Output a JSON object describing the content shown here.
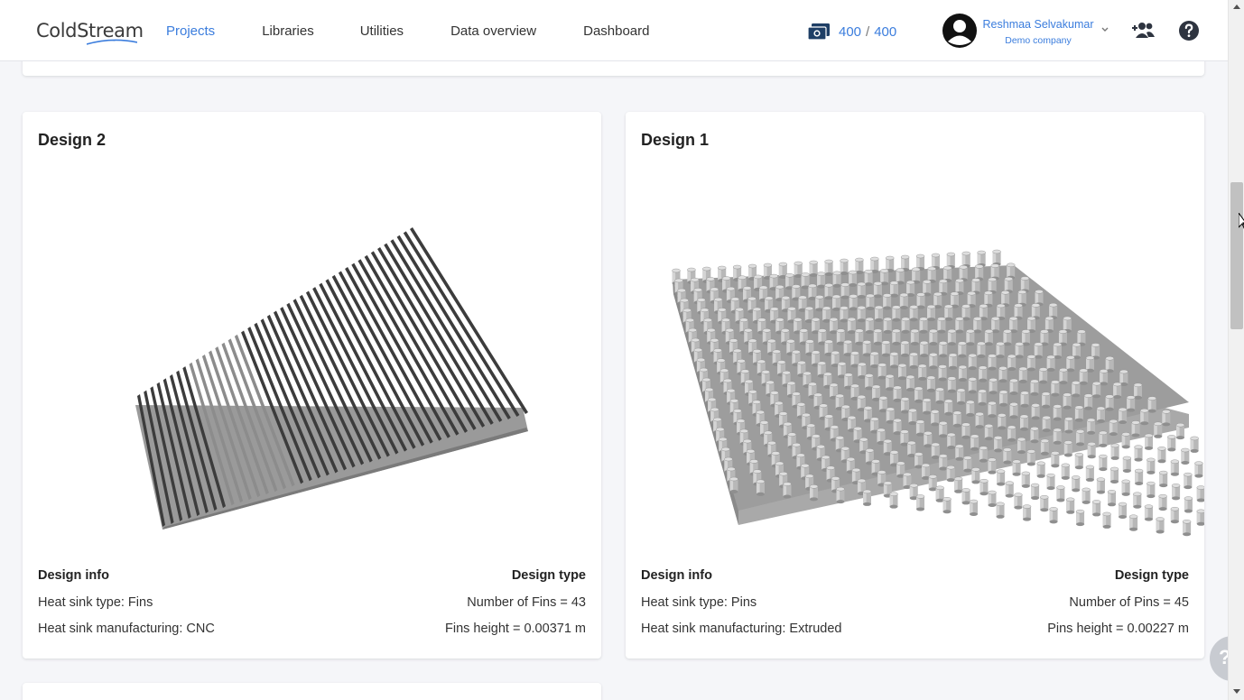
{
  "header": {
    "logo_text": "ColdStream",
    "nav": [
      {
        "label": "Projects",
        "active": true
      },
      {
        "label": "Libraries",
        "active": false
      },
      {
        "label": "Utilities",
        "active": false
      },
      {
        "label": "Data overview",
        "active": false
      },
      {
        "label": "Dashboard",
        "active": false
      }
    ],
    "credits_used": "400",
    "credits_separator": "/",
    "credits_total": "400",
    "user_name": "Reshmaa Selvakumar",
    "user_company": "Demo company",
    "icons": {
      "credits": "money-icon",
      "avatar": "user-avatar-icon",
      "dropdown": "chevron-down-icon",
      "add_user": "add-user-icon",
      "help": "help-icon"
    },
    "accent_color": "#3b7ddd"
  },
  "designs": [
    {
      "title": "Design 2",
      "info_heading": "Design info",
      "type_heading": "Design type",
      "heat_sink_type": "Heat sink type: Fins",
      "manufacturing": "Heat sink manufacturing: CNC",
      "count": "Number of Fins = 43",
      "height": "Fins height = 0.00371 m"
    },
    {
      "title": "Design 1",
      "info_heading": "Design info",
      "type_heading": "Design type",
      "heat_sink_type": "Heat sink type: Pins",
      "manufacturing": "Heat sink manufacturing: Extruded",
      "count": "Number of Pins = 45",
      "height": "Pins height = 0.00227 m"
    }
  ],
  "floating_help_label": "?"
}
